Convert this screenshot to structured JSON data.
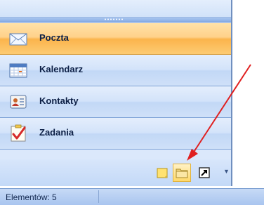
{
  "navigation": {
    "buttons": [
      {
        "label": "Poczta",
        "icon": "mail-envelope-icon",
        "active": true
      },
      {
        "label": "Kalendarz",
        "icon": "calendar-icon",
        "active": false
      },
      {
        "label": "Kontakty",
        "icon": "contact-card-icon",
        "active": false
      },
      {
        "label": "Zadania",
        "icon": "task-checkmark-icon",
        "active": false
      }
    ],
    "bottom_icons": [
      "notes-icon",
      "folder-icon",
      "shortcut-icon",
      "chevron-down-icon"
    ]
  },
  "status_bar": {
    "items_label": "Elementów: 5"
  },
  "colors": {
    "active_button": "#fbb44c",
    "annotation_arrow": "#e02020",
    "pane_blue": "#c2d8f6"
  }
}
